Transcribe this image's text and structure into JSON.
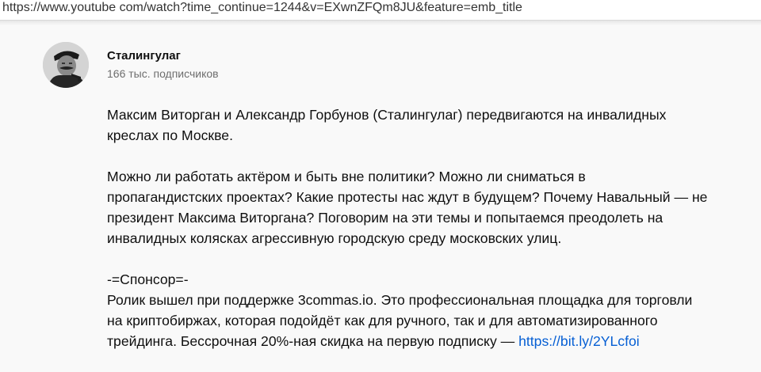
{
  "browser": {
    "url": "https://www.youtube com/watch?time_continue=1244&v=EXwnZFQm8JU&feature=emb_title"
  },
  "channel": {
    "name": "Сталингулаг",
    "subscribers": "166 тыс. подписчиков"
  },
  "description": {
    "para1_line1": "Максим Виторган и Александр Горбунов (Сталингулаг) передвигаются на инвалидных",
    "para1_line2": "креслах по Москве.",
    "para2_line1": "Можно ли работать актёром и быть вне политики? Можно ли сниматься в",
    "para2_line2": "пропагандистских проектах? Какие протесты нас ждут в будущем? Почему Навальный — не",
    "para2_line3": "президент Максима Виторгана? Поговорим на эти темы и попытаемся преодолеть на",
    "para2_line4": "инвалидных колясках агрессивную городскую среду московских улиц.",
    "sponsor_header": "-=Спонсор=-",
    "sponsor_line1": "Ролик вышел при поддержке 3commas.io. Это профессиональная площадка для торговли",
    "sponsor_line2": "на криптобиржах, которая подойдёт как для ручного, так и для автоматизированного",
    "sponsor_line3_text": "трейдинга. Бессрочная 20%-ная скидка на первую подписку — ",
    "sponsor_link": "https://bit.ly/2YLcfoi"
  },
  "colors": {
    "background": "#f9f9f9",
    "link": "#065fd4",
    "secondary_text": "#6e6e6e"
  }
}
